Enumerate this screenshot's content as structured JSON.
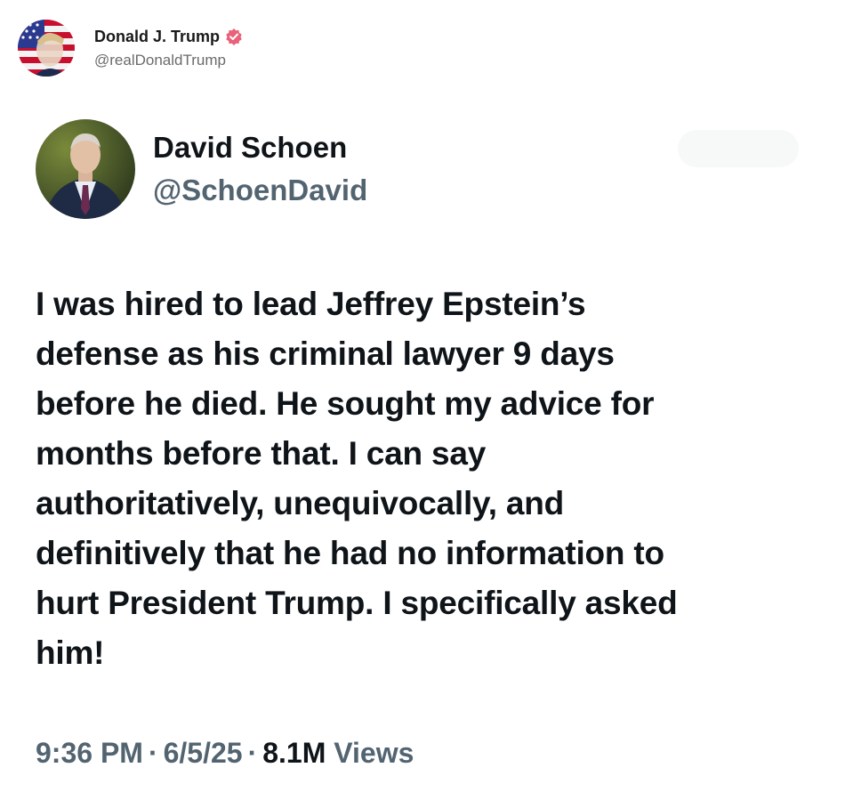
{
  "outer_post": {
    "author_name": "Donald J. Trump",
    "author_handle": "@realDonaldTrump",
    "verified_icon": "verified-badge-icon",
    "badge_color": "#e8627a"
  },
  "embedded_post": {
    "author_name": "David Schoen",
    "author_handle": "@SchoenDavid",
    "text": "I was hired to lead Jeffrey Epstein’s\ndefense as his criminal lawyer 9 days\nbefore he died.  He sought my advice for\nmonths before that.  I can say\nauthoritatively, unequivocally, and\ndefinitively that he had no information to\nhurt President Trump.  I specifically asked\nhim!",
    "time": "9:36 PM",
    "separator": "·",
    "date": "6/5/25",
    "views_count": "8.1M",
    "views_label": "Views"
  },
  "colors": {
    "text_primary": "#0f1419",
    "text_secondary": "#536471"
  }
}
